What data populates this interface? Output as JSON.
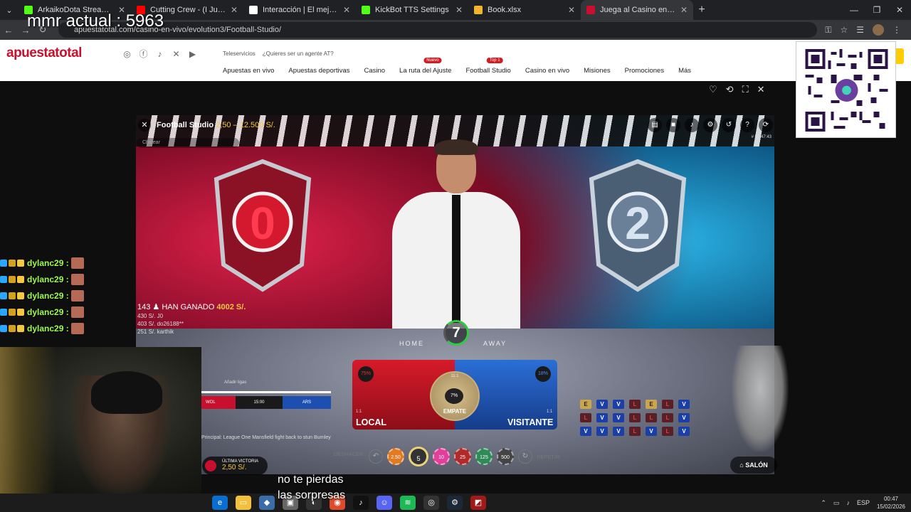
{
  "overlay": {
    "mmr": "mmr actual : 5963",
    "subtitle_line1": "no te pierdas",
    "subtitle_line2": "las sorpresas"
  },
  "tabs": [
    {
      "title": "ArkaikoDota Stream - Watch Li",
      "color": "#53fc18"
    },
    {
      "title": "Cutting Crew - (I Just) Died in Y",
      "color": "#ff0000"
    },
    {
      "title": "Interacción | El mejor software p",
      "color": "#ffffff"
    },
    {
      "title": "KickBot TTS Settings",
      "color": "#53fc18"
    },
    {
      "title": "Book.xlsx",
      "color": "#f2b233"
    },
    {
      "title": "Juega al Casino en vivo Onl",
      "color": "#c8102e"
    }
  ],
  "browser": {
    "url": "apuestatotal.com/casino-en-vivo/evolution3/Football-Studio/"
  },
  "site": {
    "logo": "apuestatotal",
    "top_links": {
      "service": "Teleservicios",
      "agent": "¿Quieres ser un agente AT?"
    },
    "nav": [
      {
        "label": "Apuestas en vivo",
        "pill": ""
      },
      {
        "label": "Apuestas deportivas",
        "pill": ""
      },
      {
        "label": "Casino",
        "pill": ""
      },
      {
        "label": "La ruta del Ajuste",
        "pill": "Nuevo"
      },
      {
        "label": "Football Studio",
        "pill": "Top 1"
      },
      {
        "label": "Casino en vivo",
        "pill": ""
      },
      {
        "label": "Misiones",
        "pill": ""
      },
      {
        "label": "Promociones",
        "pill": ""
      },
      {
        "label": "Más",
        "pill": ""
      }
    ]
  },
  "game": {
    "title": "Football Studio",
    "range": "2,50 – 12.500 S/.",
    "chat_placeholder": "Chatear",
    "code": "# 05:47:43",
    "shield_left": "0",
    "shield_right": "2",
    "winners_count": "143",
    "winners_text": "HAN GANADO",
    "winners_amount": "4002 S/.",
    "winners_list": [
      "430 S/.  J0",
      "403 S/.  do26188**",
      "251 S/.  karthik"
    ],
    "timer": "7",
    "table_home": "HOME",
    "table_away": "AWAY",
    "local": {
      "label": "LOCAL",
      "pct": "75%",
      "odds": "1:1"
    },
    "visit": {
      "label": "VISITANTE",
      "pct": "18%",
      "odds": "1:1"
    },
    "tie": {
      "label": "EMPATE",
      "pct": "7%",
      "odds": "11:1"
    },
    "undo": "DESHACER",
    "repeat": "REPETIR",
    "chips": [
      {
        "value": "2.50",
        "color": "#e07b24"
      },
      {
        "value": "5",
        "color": "#333333"
      },
      {
        "value": "10",
        "color": "#e0409a"
      },
      {
        "value": "25",
        "color": "#b02a2a"
      },
      {
        "value": "125",
        "color": "#2e8b57"
      },
      {
        "value": "500",
        "color": "#444444"
      }
    ],
    "livescore": {
      "add": "Añadir ligas",
      "team_a": "WOL",
      "time": "15:00",
      "team_b": "ARS"
    },
    "ticker": "Principal: League One Mansfield fight back to stun Burnley",
    "last_win_label": "ÚLTIMA VICTORIA",
    "last_win_value": "2,50 S/.",
    "salon": "SALÓN",
    "history": [
      [
        "E",
        "V",
        "V",
        "L",
        "E",
        "L",
        "V"
      ],
      [
        "L",
        "V",
        "V",
        "L",
        "L",
        "L",
        "V"
      ],
      [
        "V",
        "V",
        "V",
        "L",
        "V",
        "L",
        "V"
      ]
    ]
  },
  "chat": [
    {
      "user": "dylanc29"
    },
    {
      "user": "dylanc29"
    },
    {
      "user": "dylanc29"
    },
    {
      "user": "dylanc29"
    },
    {
      "user": "dylanc29"
    }
  ],
  "taskbar": {
    "lang": "ESP",
    "time": "00:47",
    "date": "15/02/2026"
  }
}
